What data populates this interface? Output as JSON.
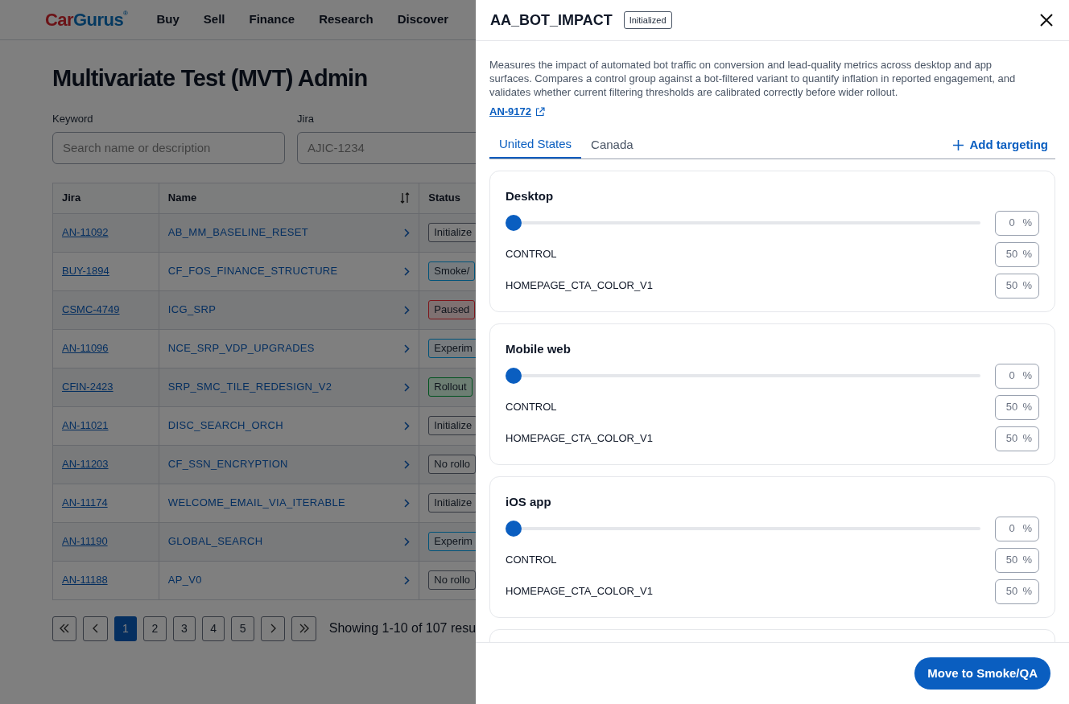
{
  "header": {
    "logo": {
      "part_1": "Car",
      "part_2": "Gurus",
      "mark": "®"
    },
    "nav": [
      "Buy",
      "Sell",
      "Finance",
      "Research",
      "Discover"
    ]
  },
  "page_title": "Multivariate Test (MVT) Admin",
  "filters": [
    {
      "label": "Keyword",
      "placeholder": "Search name or description"
    },
    {
      "label": "Jira",
      "placeholder": "AJIC-1234"
    }
  ],
  "table": {
    "columns": [
      "Jira",
      "Name",
      "Status"
    ],
    "rows": [
      {
        "jira": "AN-11092",
        "name": "AB_MM_BASELINE_RESET",
        "status": "Initialize",
        "kind": "neutral"
      },
      {
        "jira": "BUY-1894",
        "name": "CF_FOS_FINANCE_STRUCTURE",
        "status": "Smoke/",
        "kind": "blue"
      },
      {
        "jira": "CSMC-4749",
        "name": "ICG_SRP",
        "status": "Paused",
        "kind": "red"
      },
      {
        "jira": "AN-11096",
        "name": "NCE_SRP_VDP_UPGRADES",
        "status": "Experim",
        "kind": "blue"
      },
      {
        "jira": "CFIN-2423",
        "name": "SRP_SMC_TILE_REDESIGN_V2",
        "status": "Rollout",
        "kind": "green"
      },
      {
        "jira": "AN-11021",
        "name": "DISC_SEARCH_ORCH",
        "status": "Initialize",
        "kind": "neutral"
      },
      {
        "jira": "AN-11203",
        "name": "CF_SSN_ENCRYPTION",
        "status": "No rollo",
        "kind": "neutral"
      },
      {
        "jira": "AN-11174",
        "name": "WELCOME_EMAIL_VIA_ITERABLE",
        "status": "Initialize",
        "kind": "neutral"
      },
      {
        "jira": "AN-11190",
        "name": "GLOBAL_SEARCH",
        "status": "Experim",
        "kind": "blue"
      },
      {
        "jira": "AN-11188",
        "name": "AP_V0",
        "status": "No rollo",
        "kind": "neutral"
      }
    ]
  },
  "pagination": {
    "pages": [
      {
        "label": "1",
        "selected": true
      },
      {
        "label": "2",
        "selected": false
      },
      {
        "label": "3",
        "selected": false
      },
      {
        "label": "4",
        "selected": false
      },
      {
        "label": "5",
        "selected": false
      }
    ],
    "summary": "Showing 1-10 of 107 resu"
  },
  "drawer": {
    "title": "AA_BOT_IMPACT",
    "status": "Initialized",
    "description": "Measures the impact of automated bot traffic on conversion and lead-quality metrics across desktop and app surfaces. Compares a control group against a bot-filtered variant to quantify inflation in reported engagement, and validates whether current filtering thresholds are calibrated correctly before wider rollout.",
    "link": "AN-9172",
    "tabs": [
      {
        "label": "United States",
        "selected": true
      },
      {
        "label": "Canada",
        "selected": false
      }
    ],
    "add_targeting": "Add targeting",
    "platforms": [
      {
        "name": "Desktop",
        "level": 0,
        "value": "0",
        "unit": "%",
        "variants": [
          {
            "name": "CONTROL",
            "value": "50",
            "unit": "%"
          },
          {
            "name": "HOMEPAGE_CTA_COLOR_V1",
            "value": "50",
            "unit": "%"
          }
        ]
      },
      {
        "name": "Mobile web",
        "level": 0,
        "value": "0",
        "unit": "%",
        "variants": [
          {
            "name": "CONTROL",
            "value": "50",
            "unit": "%"
          },
          {
            "name": "HOMEPAGE_CTA_COLOR_V1",
            "value": "50",
            "unit": "%"
          }
        ]
      },
      {
        "name": "iOS app",
        "level": 0,
        "value": "0",
        "unit": "%",
        "variants": [
          {
            "name": "CONTROL",
            "value": "50",
            "unit": "%"
          },
          {
            "name": "HOMEPAGE_CTA_COLOR_V1",
            "value": "50",
            "unit": "%"
          }
        ]
      }
    ],
    "primary_button": "Move to Smoke/QA"
  }
}
